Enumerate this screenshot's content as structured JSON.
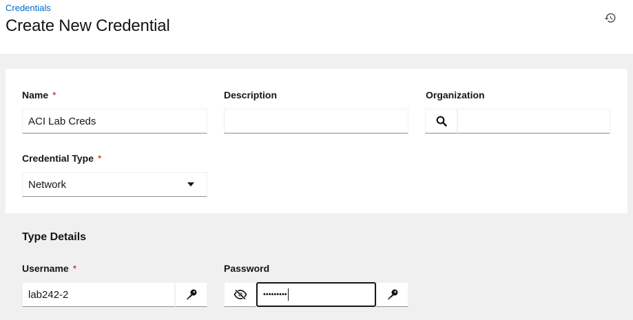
{
  "header": {
    "breadcrumb": "Credentials",
    "title": "Create New Credential"
  },
  "form": {
    "name": {
      "label": "Name",
      "required_mark": "*",
      "value": "ACI Lab Creds"
    },
    "description": {
      "label": "Description",
      "value": ""
    },
    "organization": {
      "label": "Organization",
      "value": ""
    },
    "credential_type": {
      "label": "Credential Type",
      "required_mark": "*",
      "value": "Network"
    }
  },
  "type_details": {
    "title": "Type Details",
    "username": {
      "label": "Username",
      "required_mark": "*",
      "value": "lab242-2"
    },
    "password": {
      "label": "Password",
      "masked_value": "•••••••••"
    }
  },
  "icons": {
    "history": "history-icon",
    "search": "search-icon",
    "key": "key-icon",
    "eye_slash": "eye-slash-icon"
  },
  "colors": {
    "link": "#0066cc",
    "required": "#c9190b",
    "text": "#151515",
    "background": "#f0f0f0"
  }
}
